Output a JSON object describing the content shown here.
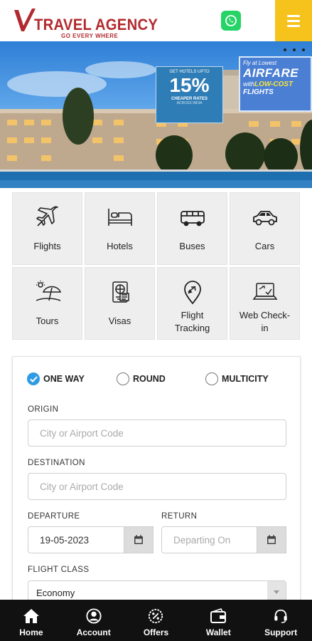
{
  "header": {
    "brand": "TRAVEL AGENCY",
    "tagline": "GO EVERY WHERE",
    "whatsapp_icon": "whatsapp-icon",
    "menu_icon": "hamburger-menu-icon",
    "accent_color": "#f6c21c",
    "brand_color": "#b22a2e"
  },
  "banner": {
    "promo_small": "GET HOTELS UPTO",
    "promo_percent": "15%",
    "promo_sub": "CHEAPER RATES",
    "promo_tiny": "ACROSS INDIA",
    "airfare_l1": "Fly at Lowest",
    "airfare_l2": "AIRFARE",
    "airfare_l3a": "with",
    "airfare_l3b": "LOW-COST",
    "airfare_l4": "FLIGHTS"
  },
  "services": [
    {
      "label": "Flights",
      "icon": "airplane-icon"
    },
    {
      "label": "Hotels",
      "icon": "bed-icon"
    },
    {
      "label": "Buses",
      "icon": "bus-icon"
    },
    {
      "label": "Cars",
      "icon": "car-icon"
    },
    {
      "label": "Tours",
      "icon": "beach-umbrella-icon"
    },
    {
      "label": "Visas",
      "icon": "passport-icon"
    },
    {
      "label": "Flight Tracking",
      "icon": "location-plane-icon"
    },
    {
      "label": "Web Check-in",
      "icon": "laptop-checkin-icon"
    }
  ],
  "form": {
    "trip_types": [
      "ONE WAY",
      "ROUND",
      "MULTICITY"
    ],
    "selected_trip": "ONE WAY",
    "origin_label": "ORIGIN",
    "origin_placeholder": "City or Airport Code",
    "destination_label": "DESTINATION",
    "destination_placeholder": "City or Airport Code",
    "departure_label": "DEPARTURE",
    "departure_value": "19-05-2023",
    "return_label": "RETURN",
    "return_placeholder": "Departing On",
    "class_label": "FLIGHT CLASS",
    "class_value": "Economy"
  },
  "bottom_nav": [
    {
      "label": "Home",
      "icon": "home-icon"
    },
    {
      "label": "Account",
      "icon": "account-icon"
    },
    {
      "label": "Offers",
      "icon": "offers-icon"
    },
    {
      "label": "Wallet",
      "icon": "wallet-icon"
    },
    {
      "label": "Support",
      "icon": "headset-icon"
    }
  ]
}
